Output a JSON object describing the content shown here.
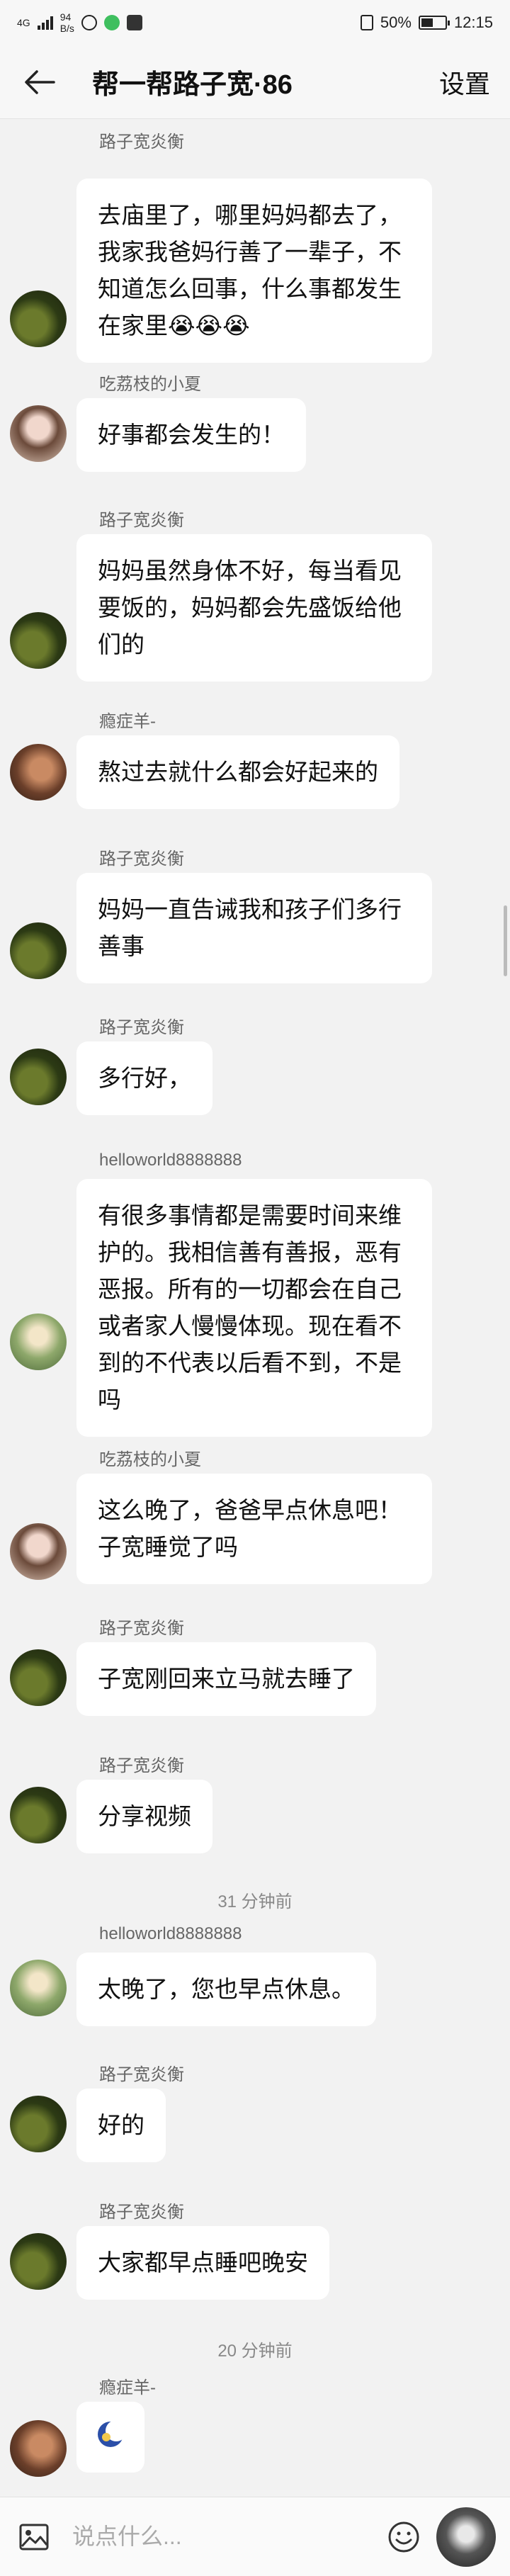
{
  "status_bar": {
    "network": "4G",
    "speed_value": "94",
    "speed_unit": "B/s",
    "battery": "50%",
    "battery_level": 0.5,
    "time": "12:15"
  },
  "header": {
    "title": "帮一帮路子宽·86",
    "settings_label": "设置"
  },
  "messages": [
    {
      "sender": "路子宽炎衡",
      "text": "去庙里了，哪里妈妈都去了，我家我爸妈行善了一辈子，不知道怎么回事，什么事都发生在家里😭😭😭"
    },
    {
      "sender": "吃荔枝的小夏",
      "text": "好事都会发生的！"
    },
    {
      "sender": "路子宽炎衡",
      "text": "妈妈虽然身体不好，每当看见要饭的，妈妈都会先盛饭给他们的"
    },
    {
      "sender": "瘾症羊-",
      "text": "熬过去就什么都会好起来的"
    },
    {
      "sender": "路子宽炎衡",
      "text": "妈妈一直告诫我和孩子们多行善事"
    },
    {
      "sender": "路子宽炎衡",
      "text": "多行好，"
    },
    {
      "sender": "helloworld8888888",
      "text": "有很多事情都是需要时间来维护的。我相信善有善报，恶有恶报。所有的一切都会在自己或者家人慢慢体现。现在看不到的不代表以后看不到，不是吗"
    },
    {
      "sender": "吃荔枝的小夏",
      "text": "这么晚了，爸爸早点休息吧！子宽睡觉了吗"
    },
    {
      "sender": "路子宽炎衡",
      "text": "子宽刚回来立马就去睡了"
    },
    {
      "sender": "路子宽炎衡",
      "text": "分享视频"
    },
    {
      "sender": "helloworld8888888",
      "text": "太晚了，您也早点休息。"
    },
    {
      "sender": "路子宽炎衡",
      "text": "好的"
    },
    {
      "sender": "路子宽炎衡",
      "text": "大家都早点睡吧晚安"
    },
    {
      "sender": "瘾症羊-",
      "text": ""
    }
  ],
  "timestamps": [
    "31 分钟前",
    "20 分钟前"
  ],
  "input": {
    "placeholder": "说点什么..."
  },
  "icons": {
    "back": "arrow-left-icon",
    "image": "image-icon",
    "emoji": "emoji-icon",
    "sticker": "moon-sticker-icon"
  },
  "colors": {
    "background": "#f2f2f2",
    "bubble": "#ffffff",
    "header": "#f7f7f7"
  }
}
